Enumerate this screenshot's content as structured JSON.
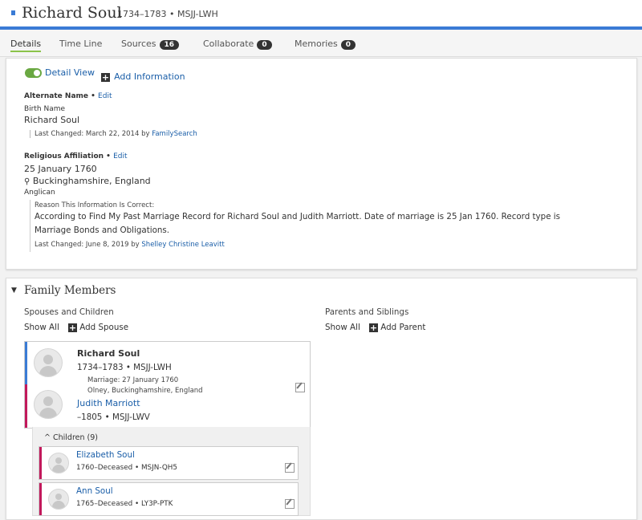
{
  "header": {
    "name": "Richard Soul",
    "lifespan_id": "1734–1783 • MSJJ-LWH"
  },
  "tabs": [
    {
      "label": "Details"
    },
    {
      "label": "Time Line"
    },
    {
      "label": "Sources",
      "count": "16"
    },
    {
      "label": "Collaborate",
      "count": "0"
    },
    {
      "label": "Memories",
      "count": "0"
    }
  ],
  "details": {
    "detail_view_label": "Detail View",
    "add_information_label": "Add Information",
    "alternate_name": {
      "title": "Alternate Name",
      "edit": "Edit",
      "type": "Birth Name",
      "value": "Richard Soul",
      "last_changed": "Last Changed: March 22, 2014 by",
      "changed_by": "FamilySearch"
    },
    "religious_affiliation": {
      "title": "Religious Affiliation",
      "edit": "Edit",
      "date": "25 January 1760",
      "place": "Buckinghamshire, England",
      "value": "Anglican",
      "reason_label": "Reason This Information Is Correct:",
      "reason_line1": "According to Find My Past Marriage Record for Richard Soul and Judith Marriott. Date of marriage is 25 Jan 1760. Record type is",
      "reason_line2": "Marriage Bonds and Obligations.",
      "last_changed": "Last Changed: June 8, 2019 by",
      "changed_by": "Shelley Christine Leavitt"
    }
  },
  "family": {
    "title": "Family Members",
    "spouses_heading": "Spouses and Children",
    "parents_heading": "Parents and Siblings",
    "show_all": "Show All",
    "add_spouse": "Add Spouse",
    "add_parent": "Add Parent",
    "husband": {
      "name": "Richard Soul",
      "info": "1734–1783 • MSJJ-LWH"
    },
    "marriage": {
      "date": "Marriage: 27 January 1760",
      "place": "Olney, Buckinghamshire, England"
    },
    "wife": {
      "name": "Judith Marriott",
      "info": "–1805 • MSJJ-LWV"
    },
    "children_label": "Children (9)",
    "children": [
      {
        "name": "Elizabeth Soul",
        "info": "1760–Deceased • MSJN-QH5"
      },
      {
        "name": "Ann Soul",
        "info": "1765–Deceased • LY3P-PTK"
      }
    ]
  },
  "colors": {
    "accent_blue": "#3a7bd5",
    "male_bar": "#3a7bd5",
    "female_bar": "#c2185b",
    "toggle_green": "#6aa842"
  }
}
